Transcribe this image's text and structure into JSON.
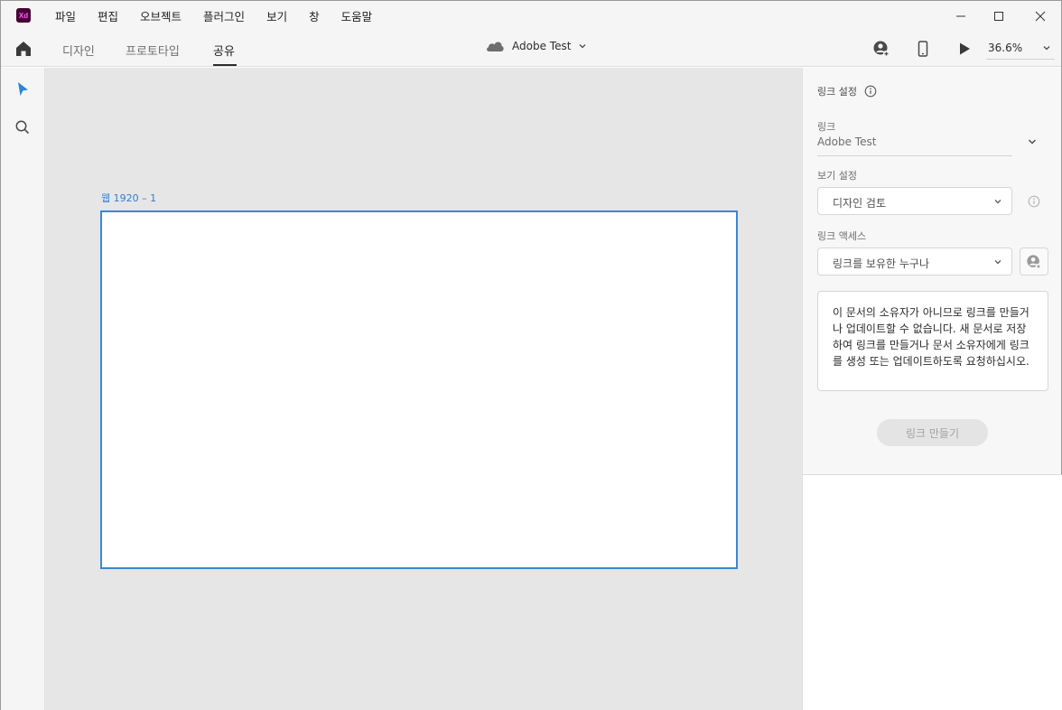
{
  "app": {
    "logo_text": "Xd"
  },
  "menu": [
    "파일",
    "편집",
    "오브젝트",
    "플러그인",
    "보기",
    "창",
    "도움말"
  ],
  "toolbar": {
    "tabs": [
      "디자인",
      "프로토타입",
      "공유"
    ],
    "active_tab": "공유",
    "doc_title": "Adobe Test",
    "zoom": "36.6%"
  },
  "canvas": {
    "artboard_label": "웹 1920 – 1",
    "accent_color": "#3a87d6"
  },
  "panel": {
    "heading": "링크 설정",
    "link_label": "링크",
    "link_value": "Adobe Test",
    "view_label": "보기 설정",
    "view_value": "디자인 검토",
    "access_label": "링크 액세스",
    "access_value": "링크를 보유한 누구나",
    "notice": "이 문서의 소유자가 아니므로 링크를 만들거나 업데이트할 수 없습니다. 새 문서로 저장하여 링크를 만들거나 문서 소유자에게 링크를 생성 또는 업데이트하도록 요청하십시오.",
    "create_button": "링크 만들기"
  }
}
